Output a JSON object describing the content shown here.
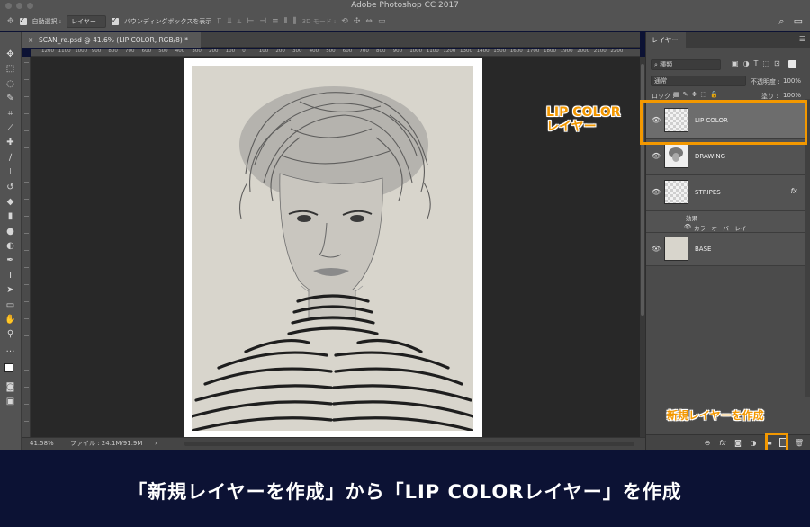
{
  "app": {
    "title": "Adobe Photoshop CC 2017"
  },
  "options_bar": {
    "auto_select_label": "自動選択 :",
    "auto_select_value": "レイヤー",
    "bounding_box_label": "バウンディングボックスを表示",
    "mode_3d_label": "3D モード :"
  },
  "document": {
    "tab_title": "SCAN_re.psd @ 41.6% (LIP COLOR, RGB/8) *",
    "tab_close": "×",
    "ruler_marks": [
      "1200",
      "1100",
      "1000",
      "900",
      "800",
      "700",
      "600",
      "500",
      "400",
      "300",
      "200",
      "100",
      "0",
      "100",
      "200",
      "300",
      "400",
      "500",
      "600",
      "700",
      "800",
      "900",
      "1000",
      "1100",
      "1200",
      "1300",
      "1400",
      "1500",
      "1600",
      "1700",
      "1800",
      "1900",
      "2000",
      "2100",
      "2200",
      "2300"
    ]
  },
  "status": {
    "zoom": "41.58%",
    "file_info": "ファイル : 24.1M/91.9M",
    "arrow": "›"
  },
  "layers_panel": {
    "tab_label": "レイヤー",
    "filter_kind": "種類",
    "blend_mode": "通常",
    "opacity_label": "不透明度 :",
    "opacity_value": "100%",
    "lock_label": "ロック :",
    "fill_label": "塗り :",
    "fill_value": "100%",
    "layers": [
      {
        "name": "LIP COLOR",
        "selected": true
      },
      {
        "name": "DRAWING",
        "selected": false
      },
      {
        "name": "STRIPES",
        "selected": false,
        "fx": "fx"
      },
      {
        "name": "BASE",
        "selected": false
      }
    ],
    "effects_label": "効果",
    "effect_name": "カラーオーバーレイ",
    "bottom_icons": [
      "link-icon",
      "fx-icon",
      "mask-icon",
      "adjustment-icon",
      "folder-icon",
      "new-layer-icon",
      "trash-icon"
    ]
  },
  "annotations": {
    "lip_layer_line1": "LIP COLOR",
    "lip_layer_line2": "レイヤー",
    "new_layer": "新規レイヤーを作成",
    "accent_color": "#f39800"
  },
  "caption": "「新規レイヤーを作成」から「LIP COLORレイヤー」を作成"
}
